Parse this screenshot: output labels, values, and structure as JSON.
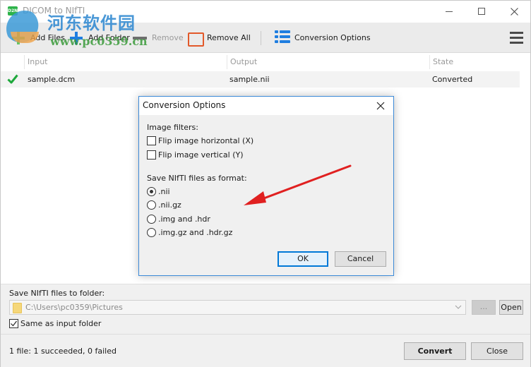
{
  "window": {
    "title": "DICOM to NIfTI",
    "app_icon_text": "D2N",
    "controls": {
      "minimize": "minimize",
      "maximize": "maximize",
      "close": "close"
    }
  },
  "toolbar": {
    "add_files": "Add Files",
    "add_folder": "Add Folder",
    "remove": "Remove",
    "remove_all": "Remove All",
    "conversion_options": "Conversion Options",
    "menu_icon": "hamburger-menu-icon"
  },
  "file_list": {
    "columns": [
      "Input",
      "Output",
      "State"
    ],
    "rows": [
      {
        "status_icon": "check-icon",
        "input": "sample.dcm",
        "output": "sample.nii",
        "state": "Converted"
      }
    ]
  },
  "output_folder": {
    "label": "Save NIfTI files to folder:",
    "path": "C:\\Users\\pc0359\\Pictures",
    "browse_label": "...",
    "open_label": "Open",
    "same_as_input_label": "Same as input folder",
    "same_as_input_checked": true
  },
  "status": {
    "text": "1 file: 1 succeeded, 0 failed"
  },
  "actions": {
    "convert": "Convert",
    "close": "Close"
  },
  "dialog": {
    "title": "Conversion Options",
    "image_filters_label": "Image filters:",
    "filters": [
      {
        "label": "Flip image horizontal (X)",
        "checked": false
      },
      {
        "label": "Flip image vertical (Y)",
        "checked": false
      }
    ],
    "format_label": "Save NIfTI files as format:",
    "formats": [
      {
        "label": ".nii",
        "selected": true
      },
      {
        "label": ".nii.gz",
        "selected": false
      },
      {
        "label": ".img and .hdr",
        "selected": false
      },
      {
        "label": ".img.gz and .hdr.gz",
        "selected": false
      }
    ],
    "ok": "OK",
    "cancel": "Cancel"
  },
  "watermark": {
    "text_cn": "河东软件园",
    "url": "www.pc0359.cn"
  },
  "colors": {
    "accent_blue": "#1f7ee0",
    "add_green": "#65c466",
    "remove_all_orange": "#e2592a",
    "check_green": "#1ea83c",
    "annotation_red": "#e02020",
    "dialog_border": "#3c8ad8"
  }
}
